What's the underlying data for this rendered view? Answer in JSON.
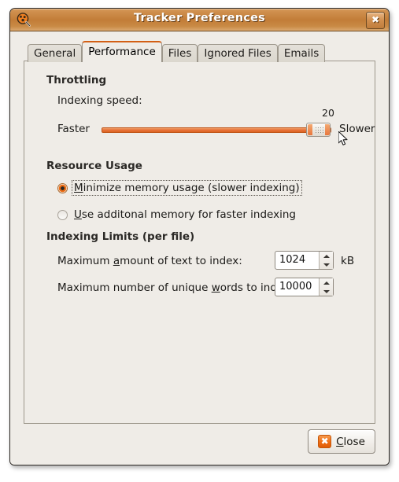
{
  "window": {
    "title": "Tracker Preferences",
    "app_icon": "tracker-magnifier-icon",
    "close_icon": "window-close-icon"
  },
  "tabs": [
    {
      "label": "General",
      "active": false
    },
    {
      "label": "Performance",
      "active": true
    },
    {
      "label": "Files",
      "active": false
    },
    {
      "label": "Ignored Files",
      "active": false
    },
    {
      "label": "Emails",
      "active": false
    }
  ],
  "throttling": {
    "section_title": "Throttling",
    "speed_label": "Indexing speed:",
    "faster_label": "Faster",
    "slower_label": "Slower",
    "value": "20",
    "slider_min": 0,
    "slider_max": 22,
    "slider_value": 20
  },
  "resource_usage": {
    "section_title": "Resource Usage",
    "options": [
      {
        "label_pre": "",
        "mnemonic": "M",
        "label_post": "inimize memory usage (slower indexing)",
        "selected": true,
        "focused": true
      },
      {
        "label_pre": "",
        "mnemonic": "U",
        "label_post": "se additonal memory for faster indexing",
        "selected": false,
        "focused": false
      }
    ]
  },
  "indexing_limits": {
    "section_title": "Indexing Limits (per file)",
    "rows": [
      {
        "label_pre": "Maximum ",
        "mnemonic": "a",
        "label_post": "mount of text to index:",
        "value": "1024",
        "unit": "kB"
      },
      {
        "label_pre": "Maximum number of unique ",
        "mnemonic": "w",
        "label_post": "ords to index:",
        "value": "10000",
        "unit": ""
      }
    ]
  },
  "footer": {
    "close_mnemonic": "C",
    "close_label_post": "lose",
    "close_icon": "close-x-icon"
  },
  "colors": {
    "accent_orange": "#ef6c13",
    "titlebar_orange": "#c27d38",
    "window_bg": "#efece7",
    "tab_active_top": "#d35f15"
  }
}
